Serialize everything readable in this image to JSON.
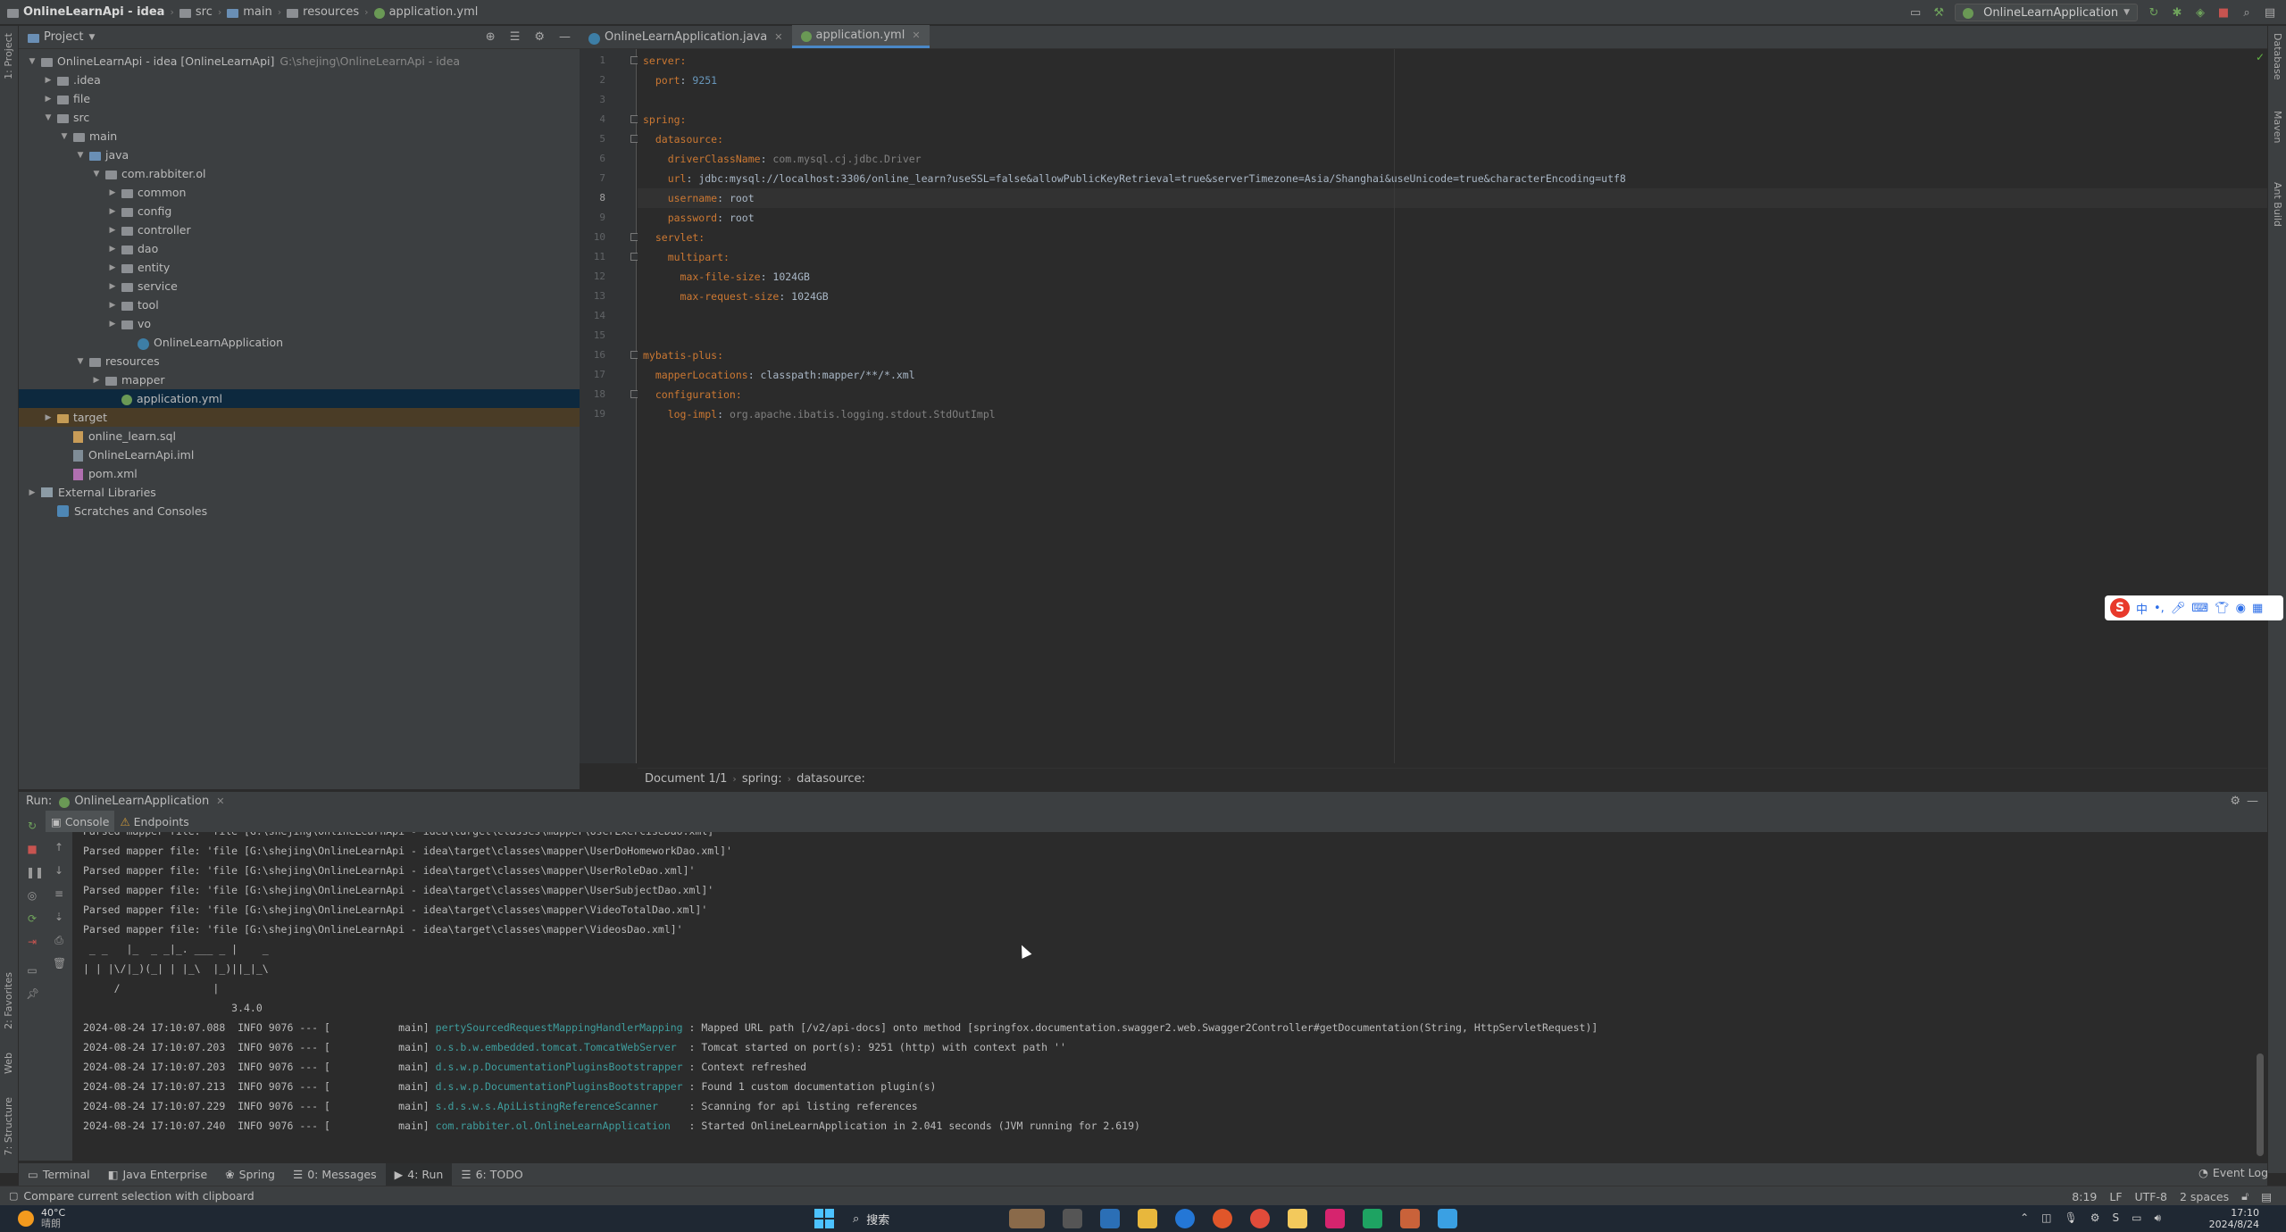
{
  "navbar": {
    "project": "OnlineLearnApi - idea",
    "crumbs": [
      "src",
      "main",
      "resources"
    ],
    "file": "application.yml",
    "run_config": "OnlineLearnApplication"
  },
  "left_stripe": {
    "project": "1: Project",
    "favorites": "2: Favorites",
    "web": "Web",
    "structure": "7: Structure"
  },
  "right_stripe": {
    "database": "Database",
    "maven": "Maven",
    "ant": "Ant Build"
  },
  "project_panel": {
    "title": "Project",
    "tree": [
      {
        "label": "OnlineLearnApi - idea [OnlineLearnApi]",
        "hint": "G:\\shejing\\OnlineLearnApi - idea",
        "depth": 0,
        "arrow": "down",
        "icon": "folder"
      },
      {
        "label": ".idea",
        "depth": 1,
        "arrow": "right",
        "icon": "folder"
      },
      {
        "label": "file",
        "depth": 1,
        "arrow": "right",
        "icon": "folder"
      },
      {
        "label": "src",
        "depth": 1,
        "arrow": "down",
        "icon": "folder"
      },
      {
        "label": "main",
        "depth": 2,
        "arrow": "down",
        "icon": "folder"
      },
      {
        "label": "java",
        "depth": 3,
        "arrow": "down",
        "icon": "folder-blue"
      },
      {
        "label": "com.rabbiter.ol",
        "depth": 4,
        "arrow": "down",
        "icon": "folder"
      },
      {
        "label": "common",
        "depth": 5,
        "arrow": "right",
        "icon": "folder"
      },
      {
        "label": "config",
        "depth": 5,
        "arrow": "right",
        "icon": "folder"
      },
      {
        "label": "controller",
        "depth": 5,
        "arrow": "right",
        "icon": "folder"
      },
      {
        "label": "dao",
        "depth": 5,
        "arrow": "right",
        "icon": "folder"
      },
      {
        "label": "entity",
        "depth": 5,
        "arrow": "right",
        "icon": "folder"
      },
      {
        "label": "service",
        "depth": 5,
        "arrow": "right",
        "icon": "folder"
      },
      {
        "label": "tool",
        "depth": 5,
        "arrow": "right",
        "icon": "folder"
      },
      {
        "label": "vo",
        "depth": 5,
        "arrow": "right",
        "icon": "folder"
      },
      {
        "label": "OnlineLearnApplication",
        "depth": 6,
        "arrow": "",
        "icon": "java"
      },
      {
        "label": "resources",
        "depth": 3,
        "arrow": "down",
        "icon": "folder"
      },
      {
        "label": "mapper",
        "depth": 4,
        "arrow": "right",
        "icon": "folder"
      },
      {
        "label": "application.yml",
        "depth": 5,
        "arrow": "",
        "icon": "yml",
        "selected": true
      },
      {
        "label": "target",
        "depth": 1,
        "arrow": "right",
        "icon": "folder-orange",
        "target": true
      },
      {
        "label": "online_learn.sql",
        "depth": 2,
        "arrow": "",
        "icon": "sql"
      },
      {
        "label": "OnlineLearnApi.iml",
        "depth": 2,
        "arrow": "",
        "icon": "iml"
      },
      {
        "label": "pom.xml",
        "depth": 2,
        "arrow": "",
        "icon": "pom"
      },
      {
        "label": "External Libraries",
        "depth": 0,
        "arrow": "right",
        "icon": "lib"
      },
      {
        "label": "Scratches and Consoles",
        "depth": 1,
        "arrow": "",
        "icon": "scratch"
      }
    ]
  },
  "editor": {
    "tabs": [
      {
        "label": "OnlineLearnApplication.java",
        "active": false
      },
      {
        "label": "application.yml",
        "active": true
      }
    ],
    "current_line": 8,
    "lines": [
      [
        {
          "t": "server:",
          "c": "k"
        }
      ],
      [
        {
          "t": "  port",
          "c": "k"
        },
        {
          "t": ": ",
          "c": "v"
        },
        {
          "t": "9251",
          "c": "n"
        }
      ],
      [],
      [
        {
          "t": "spring:",
          "c": "k"
        }
      ],
      [
        {
          "t": "  datasource:",
          "c": "k"
        }
      ],
      [
        {
          "t": "    driverClassName",
          "c": "k"
        },
        {
          "t": ": ",
          "c": "v"
        },
        {
          "t": "com.mysql.cj.jdbc.Driver",
          "c": "g"
        }
      ],
      [
        {
          "t": "    url",
          "c": "k"
        },
        {
          "t": ": jdbc:mysql://localhost:3306/online_learn?useSSL=false&allowPublicKeyRetrieval=true&serverTimezone=Asia/Shanghai&useUnicode=true&characterEncoding=utf8",
          "c": "v"
        }
      ],
      [
        {
          "t": "    username",
          "c": "k"
        },
        {
          "t": ": root",
          "c": "v"
        }
      ],
      [
        {
          "t": "    password",
          "c": "k"
        },
        {
          "t": ": root",
          "c": "v"
        }
      ],
      [
        {
          "t": "  servlet:",
          "c": "k"
        }
      ],
      [
        {
          "t": "    multipart:",
          "c": "k"
        }
      ],
      [
        {
          "t": "      max-file-size",
          "c": "k"
        },
        {
          "t": ": 1024GB",
          "c": "v"
        }
      ],
      [
        {
          "t": "      max-request-size",
          "c": "k"
        },
        {
          "t": ": 1024GB",
          "c": "v"
        }
      ],
      [],
      [],
      [
        {
          "t": "mybatis-plus:",
          "c": "k"
        }
      ],
      [
        {
          "t": "  mapperLocations",
          "c": "k"
        },
        {
          "t": ": classpath:mapper/**/*.xml",
          "c": "v"
        }
      ],
      [
        {
          "t": "  configuration:",
          "c": "k"
        }
      ],
      [
        {
          "t": "    log-impl",
          "c": "k"
        },
        {
          "t": ": ",
          "c": "v"
        },
        {
          "t": "org.apache.ibatis.logging.stdout.StdOutImpl",
          "c": "g"
        }
      ]
    ],
    "breadcrumbs": [
      "Document 1/1",
      "spring:",
      "datasource:"
    ]
  },
  "run_panel": {
    "label": "Run:",
    "tab": "OnlineLearnApplication",
    "subtabs": [
      "Console",
      "Endpoints"
    ],
    "console_lines": [
      [
        {
          "t": "Parsed mapper file: 'file [G:\\shejing\\OnlineLearnApi - idea\\target\\classes\\mapper\\UserExerciseDao.xml]'"
        }
      ],
      [
        {
          "t": "Parsed mapper file: 'file [G:\\shejing\\OnlineLearnApi - idea\\target\\classes\\mapper\\UserDoHomeworkDao.xml]'"
        }
      ],
      [
        {
          "t": "Parsed mapper file: 'file [G:\\shejing\\OnlineLearnApi - idea\\target\\classes\\mapper\\UserRoleDao.xml]'"
        }
      ],
      [
        {
          "t": "Parsed mapper file: 'file [G:\\shejing\\OnlineLearnApi - idea\\target\\classes\\mapper\\UserSubjectDao.xml]'"
        }
      ],
      [
        {
          "t": "Parsed mapper file: 'file [G:\\shejing\\OnlineLearnApi - idea\\target\\classes\\mapper\\VideoTotalDao.xml]'"
        }
      ],
      [
        {
          "t": "Parsed mapper file: 'file [G:\\shejing\\OnlineLearnApi - idea\\target\\classes\\mapper\\VideosDao.xml]'"
        }
      ],
      [
        {
          "t": " _ _   |_  _ _|_. ___ _ |    _"
        }
      ],
      [
        {
          "t": "| | |\\/|_)(_| | |_\\  |_)||_|_\\"
        }
      ],
      [
        {
          "t": "     /               |"
        }
      ],
      [
        {
          "t": "                        3.4.0"
        }
      ],
      [
        {
          "t": "2024-08-24 17:10:07.088  INFO 9076 --- [           main] "
        },
        {
          "t": "pertySourcedRequestMappingHandlerMapping",
          "c": "cls"
        },
        {
          "t": " : Mapped URL path [/v2/api-docs] onto method [springfox.documentation.swagger2.web.Swagger2Controller#getDocumentation(String, HttpServletRequest)]"
        }
      ],
      [
        {
          "t": "2024-08-24 17:10:07.203  INFO 9076 --- [           main] "
        },
        {
          "t": "o.s.b.w.embedded.tomcat.TomcatWebServer ",
          "c": "cls"
        },
        {
          "t": " : Tomcat started on port(s): 9251 (http) with context path ''"
        }
      ],
      [
        {
          "t": "2024-08-24 17:10:07.203  INFO 9076 --- [           main] "
        },
        {
          "t": "d.s.w.p.DocumentationPluginsBootstrapper",
          "c": "cls"
        },
        {
          "t": " : Context refreshed"
        }
      ],
      [
        {
          "t": "2024-08-24 17:10:07.213  INFO 9076 --- [           main] "
        },
        {
          "t": "d.s.w.p.DocumentationPluginsBootstrapper",
          "c": "cls"
        },
        {
          "t": " : Found 1 custom documentation plugin(s)"
        }
      ],
      [
        {
          "t": "2024-08-24 17:10:07.229  INFO 9076 --- [           main] "
        },
        {
          "t": "s.d.s.w.s.ApiListingReferenceScanner    ",
          "c": "cls"
        },
        {
          "t": " : Scanning for api listing references"
        }
      ],
      [
        {
          "t": "2024-08-24 17:10:07.240  INFO 9076 --- [           main] "
        },
        {
          "t": "com.rabbiter.ol.OnlineLearnApplication  ",
          "c": "cls"
        },
        {
          "t": " : Started OnlineLearnApplication in 2.041 seconds (JVM running for 2.619)"
        }
      ]
    ]
  },
  "tool_tabs": [
    {
      "label": "Terminal",
      "icon": "terminal-icon"
    },
    {
      "label": "Java Enterprise",
      "icon": "java-enterprise-icon"
    },
    {
      "label": "Spring",
      "icon": "spring-icon"
    },
    {
      "label": "0: Messages",
      "icon": "messages-icon"
    },
    {
      "label": "4: Run",
      "icon": "run-icon",
      "active": true
    },
    {
      "label": "6: TODO",
      "icon": "todo-icon"
    }
  ],
  "event_log": "Event Log",
  "status": {
    "message": "Compare current selection with clipboard",
    "position": "8:19",
    "line_sep": "LF",
    "encoding": "UTF-8",
    "indent": "2 spaces"
  },
  "taskbar": {
    "temp": "40°C",
    "weather": "晴朗",
    "search": "搜索",
    "time": "17:10",
    "date": "2024/8/24"
  },
  "ime": {
    "lang": "中"
  },
  "colors": {
    "background": "#2b2b2b",
    "panel": "#3c3f41",
    "selection": "#0d293e",
    "keyword": "#cc7832",
    "number": "#6897bb",
    "link": "#287bde"
  }
}
